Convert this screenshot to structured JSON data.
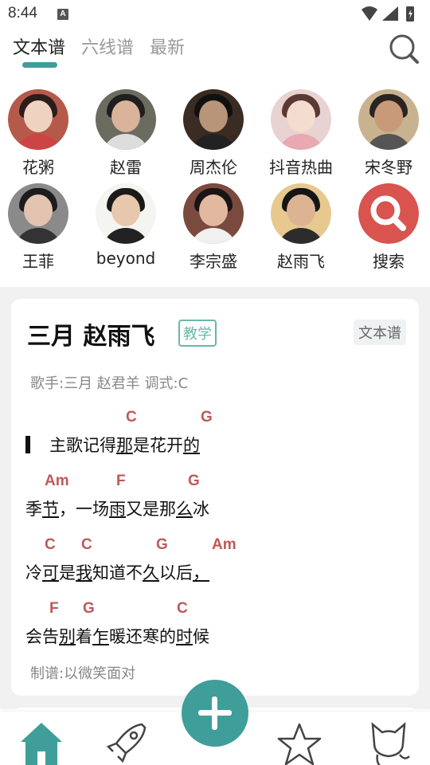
{
  "status_bar": {
    "time": "8:44",
    "notification_badge": "A"
  },
  "tabs": [
    {
      "label": "文本谱",
      "active": true
    },
    {
      "label": "六线谱",
      "active": false
    },
    {
      "label": "最新",
      "active": false
    }
  ],
  "artists": [
    {
      "name": "花粥"
    },
    {
      "name": "赵雷"
    },
    {
      "name": "周杰伦"
    },
    {
      "name": "抖音热曲"
    },
    {
      "name": "宋冬野"
    },
    {
      "name": "王菲"
    },
    {
      "name": "beyond"
    },
    {
      "name": "李宗盛"
    },
    {
      "name": "赵雨飞"
    },
    {
      "name": "搜索"
    }
  ],
  "song_card": {
    "title": "三月 赵雨飞",
    "tag_teach": "教学",
    "tag_type": "文本谱",
    "meta": "歌手:三月 赵君羊  调式:C",
    "chords": {
      "l1_c": "C",
      "l1_g": "G",
      "l2_am": "Am",
      "l2_f": "F",
      "l2_g": "G",
      "l3_c1": "C",
      "l3_c2": "C",
      "l3_g": "G",
      "l3_am": "Am",
      "l4_f": "F",
      "l4_g": "G",
      "l4_c": "C"
    },
    "lyrics": {
      "l1a": "主歌记得",
      "l1b": "那",
      "l1c": "是花开",
      "l1d": "的",
      "l2a": "季",
      "l2b": "节",
      "l2c": "，一场",
      "l2d": "雨",
      "l2e": "又是那",
      "l2f": "么",
      "l2g": "冰",
      "l3a": "冷",
      "l3b": "可",
      "l3c": "是",
      "l3d": "我",
      "l3e": "知道不",
      "l3f": "久",
      "l3g": "以后",
      "l3h": "，",
      "l4a": "会告",
      "l4b": "别",
      "l4c": "着",
      "l4d": "乍",
      "l4e": "暖还寒的",
      "l4f": "时",
      "l4g": "候"
    },
    "footer": "制谱:以微笑面对"
  },
  "colors": {
    "accent": "#3f9e99",
    "chord": "#c0585a",
    "search_red": "#d9534f"
  }
}
